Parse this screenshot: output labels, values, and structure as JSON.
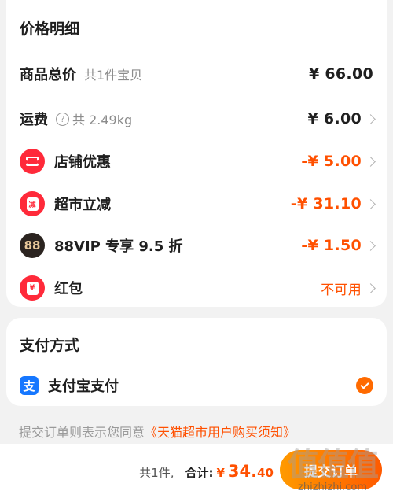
{
  "price_detail": {
    "title": "价格明细",
    "goods_total": {
      "label": "商品总价",
      "sub": "共1件宝贝",
      "amount": "¥ 66.00"
    },
    "shipping": {
      "label": "运费",
      "help_glyph": "?",
      "sub": "共 2.49kg",
      "amount": "¥ 6.00"
    },
    "discounts": [
      {
        "label": "店铺优惠",
        "amount": "-¥ 5.00",
        "icon": "coupon-icon"
      },
      {
        "label": "超市立减",
        "amount": "-¥ 31.10",
        "icon": "supermarket-discount-icon",
        "icon_text": "减"
      },
      {
        "label": "88VIP 专享 9.5 折",
        "amount": "-¥ 1.50",
        "icon": "88vip-icon",
        "icon_text": "88"
      }
    ],
    "red_packet": {
      "label": "红包",
      "status": "不可用",
      "icon": "red-packet-icon",
      "icon_text": "¥"
    }
  },
  "payment": {
    "title": "支付方式",
    "method": {
      "label": "支付宝支付",
      "icon": "alipay-icon",
      "icon_text": "支",
      "selected": true
    }
  },
  "agreement": {
    "prefix": "提交订单则表示您同意",
    "link": "《天猫超市用户购买须知》"
  },
  "footer": {
    "count": "共1件,",
    "total_label": "合计:",
    "currency": "¥",
    "amount_int": "34.",
    "amount_dec": "40",
    "submit_label": "提交订单"
  },
  "watermark": {
    "main": "值值值",
    "sub": "zhizhizhi.com"
  },
  "colors": {
    "accent": "#ff5000",
    "alipay": "#1677ff",
    "discount_icon": "#ff2a3a",
    "vip": "#2b2420"
  }
}
